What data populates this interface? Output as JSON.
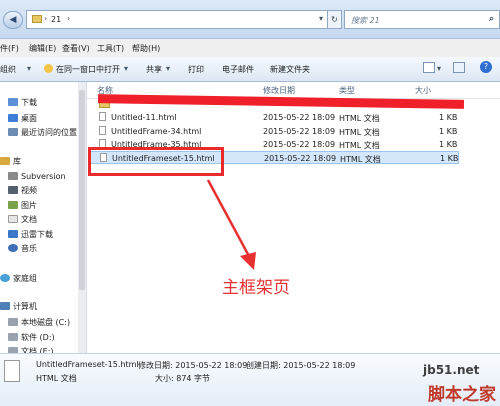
{
  "address": {
    "path": "21",
    "search_placeholder": "搜索 21"
  },
  "menu": [
    "件(F)",
    "编辑(E)",
    "查看(V)",
    "工具(T)",
    "帮助(H)"
  ],
  "toolbar": [
    "组织",
    "在同一窗口中打开",
    "共享",
    "打印",
    "电子邮件",
    "新建文件夹"
  ],
  "nav": {
    "items": [
      "下载",
      "桌面",
      "最近访问的位置",
      "库",
      "Subversion",
      "视频",
      "图片",
      "文档",
      "迅雷下载",
      "音乐",
      "家庭组",
      "计算机",
      "本地磁盘 (C:)",
      "软件 (D:)",
      "文档 (E:)"
    ]
  },
  "columns": {
    "name": "名称",
    "date": "修改日期",
    "type": "类型",
    "size": "大小"
  },
  "files": [
    {
      "name": "Untitled-11.html",
      "date": "2015-05-22 18:09",
      "type": "HTML 文档",
      "size": "1 KB"
    },
    {
      "name": "UntitledFrame-34.html",
      "date": "2015-05-22 18:09",
      "type": "HTML 文档",
      "size": "1 KB"
    },
    {
      "name": "UntitledFrame-35.html",
      "date": "2015-05-22 18:09",
      "type": "HTML 文档",
      "size": "1 KB"
    },
    {
      "name": "UntitledFrameset-15.html",
      "date": "2015-05-22 18:09",
      "type": "HTML 文档",
      "size": "1 KB"
    }
  ],
  "annotation": "主框架页",
  "status": {
    "filename": "UntitledFrameset-15.html",
    "modified_label": "修改日期: 2015-05-22 18:09",
    "created_label": "创建日期: 2015-05-22 18:09",
    "type": "HTML 文档",
    "size_label": "大小: 874 字节"
  },
  "watermark": {
    "site": "jb51.net",
    "brand": "脚本之家"
  }
}
